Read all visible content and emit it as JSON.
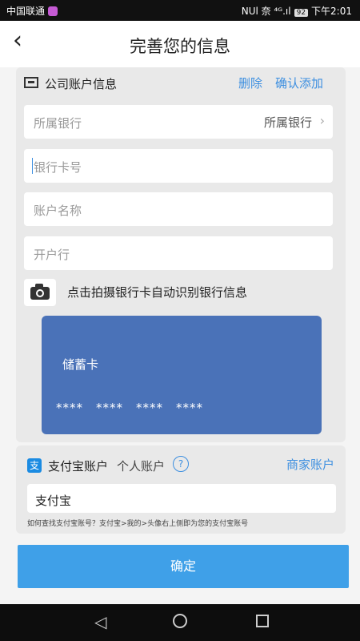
{
  "statusbar": {
    "carrier": "中国联通",
    "signal": "NUl 奈 ⁴ᴳ.ıl",
    "battery": "92",
    "time": "下午2:01"
  },
  "navbar": {
    "back_icon": "chevron-left-icon",
    "title": "完善您的信息"
  },
  "company": {
    "title": "公司账户信息",
    "delete": "删除",
    "confirm_add": "确认添加",
    "bank": {
      "placeholder": "所属银行",
      "value": "所属银行"
    },
    "card_number": {
      "placeholder": "银行卡号"
    },
    "account_name": {
      "placeholder": "账户名称"
    },
    "branch": {
      "placeholder": "开户行"
    },
    "camera_hint": "点击拍摄银行卡自动识别银行信息",
    "card": {
      "type": "储蓄卡",
      "digits": [
        "****",
        "****",
        "****",
        "****"
      ]
    }
  },
  "alipay": {
    "title": "支付宝账户",
    "personal": "个人账户",
    "help": "?",
    "merchant": "商家账户",
    "input_value": "支付宝",
    "hint": "如何查找支付宝账号？支付宝>我的>头像右上侧即为您的支付宝账号"
  },
  "confirm_button": "确定",
  "colors": {
    "accent": "#3d8fe0",
    "card_bg": "#4a72b8",
    "button": "#3fa0e8"
  }
}
